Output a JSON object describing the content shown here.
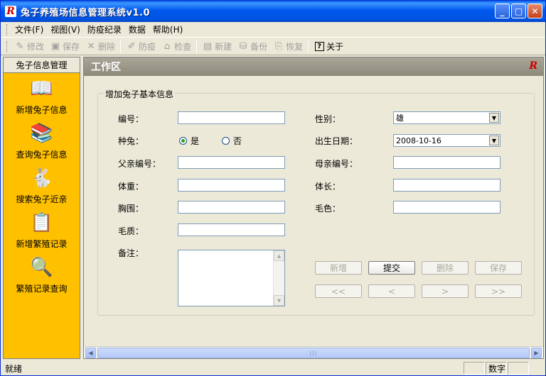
{
  "window": {
    "title": "兔子养殖场信息管理系统v1.0",
    "min_label": "_",
    "max_label": "□",
    "close_label": "✕"
  },
  "menu": [
    {
      "label": "文件(F)"
    },
    {
      "label": "视图(V)"
    },
    {
      "label": "防疫纪录"
    },
    {
      "label": "数据"
    },
    {
      "label": "帮助(H)"
    }
  ],
  "toolbar": {
    "items": [
      {
        "label": "修改",
        "icon": "✎",
        "icon_name": "edit-icon"
      },
      {
        "label": "保存",
        "icon": "▣",
        "icon_name": "save-icon"
      },
      {
        "label": "删除",
        "icon": "✕",
        "icon_name": "delete-icon"
      },
      {
        "label": "防疫",
        "icon": "✐",
        "icon_name": "vaccine-icon"
      },
      {
        "label": "检查",
        "icon": "⌂",
        "icon_name": "check-icon"
      },
      {
        "label": "新建",
        "icon": "▤",
        "icon_name": "new-icon"
      },
      {
        "label": "备份",
        "icon": "⛁",
        "icon_name": "backup-icon"
      },
      {
        "label": "恢复",
        "icon": "⎘",
        "icon_name": "restore-icon"
      },
      {
        "label": "关于",
        "icon": "?",
        "icon_name": "about-icon"
      }
    ]
  },
  "leftnav": {
    "header": "兔子信息管理",
    "items": [
      {
        "label": "新增兔子信息",
        "icon": "📖"
      },
      {
        "label": "查询兔子信息",
        "icon": "📚"
      },
      {
        "label": "搜索兔子近亲",
        "icon": "🐇"
      },
      {
        "label": "新增繁殖记录",
        "icon": "📋"
      },
      {
        "label": "繁殖记录查询",
        "icon": "🔍"
      }
    ]
  },
  "work": {
    "header": "工作区",
    "logo": "R",
    "group_title": "增加兔子基本信息",
    "labels": {
      "id": "编号：",
      "breeder": "种兔：",
      "father_id": "父亲编号：",
      "weight": "体重：",
      "chest": "胸围：",
      "fur_quality": "毛质：",
      "remarks": "备注：",
      "gender": "性别：",
      "birth_date": "出生日期：",
      "mother_id": "母亲编号：",
      "body_length": "体长：",
      "fur_color": "毛色："
    },
    "radio_yes": "是",
    "radio_no": "否",
    "gender_value": "雄",
    "birth_date_value": "2008-10-16",
    "buttons": {
      "add": "新增",
      "submit": "提交",
      "delete": "删除",
      "save": "保存",
      "first": "<<",
      "prev": "<",
      "next": ">",
      "last": ">>"
    }
  },
  "status": {
    "main": "就绪",
    "numlock": "数字"
  }
}
